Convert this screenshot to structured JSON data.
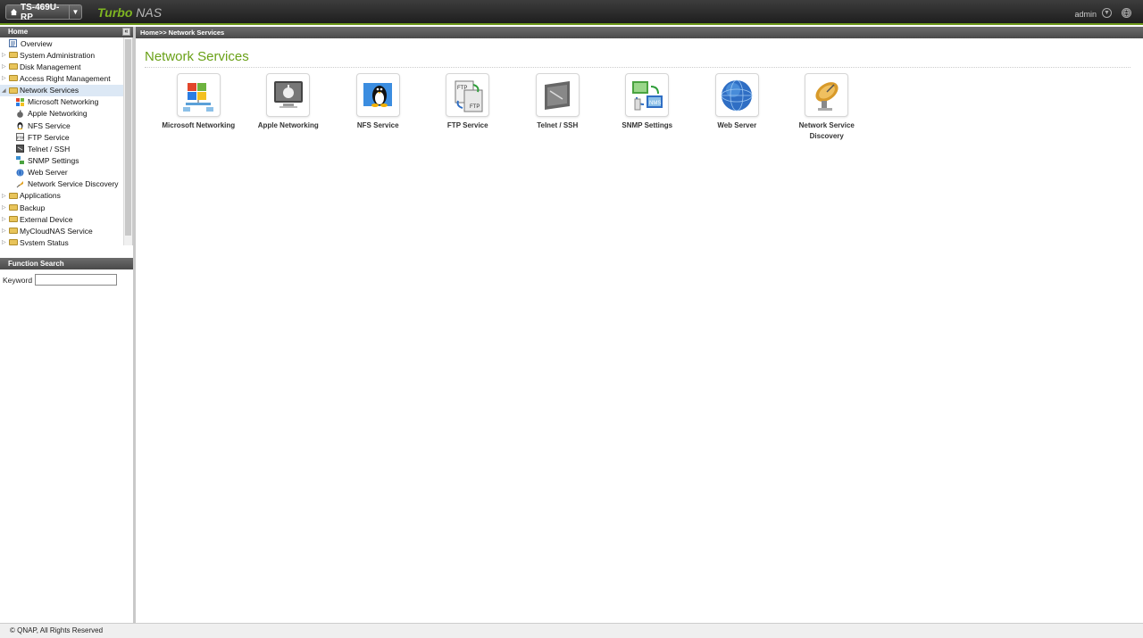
{
  "header": {
    "device_name": "TS-469U-RP",
    "brand_part1": "Turbo",
    "brand_part2": "NAS",
    "user": "admin"
  },
  "left_panel": {
    "title": "Home",
    "collapse_glyph": "«",
    "tree": [
      {
        "label": "Overview",
        "level": 0,
        "icon": "overview-icon"
      },
      {
        "label": "System Administration",
        "level": 0,
        "icon": "folder-icon"
      },
      {
        "label": "Disk Management",
        "level": 0,
        "icon": "folder-icon"
      },
      {
        "label": "Access Right Management",
        "level": 0,
        "icon": "folder-icon"
      },
      {
        "label": "Network Services",
        "level": 0,
        "icon": "folder-open-icon",
        "selected": true
      },
      {
        "label": "Microsoft Networking",
        "level": 1,
        "icon": "windows-icon"
      },
      {
        "label": "Apple Networking",
        "level": 1,
        "icon": "apple-icon"
      },
      {
        "label": "NFS Service",
        "level": 1,
        "icon": "linux-icon"
      },
      {
        "label": "FTP Service",
        "level": 1,
        "icon": "ftp-icon"
      },
      {
        "label": "Telnet / SSH",
        "level": 1,
        "icon": "terminal-icon"
      },
      {
        "label": "SNMP Settings",
        "level": 1,
        "icon": "snmp-icon"
      },
      {
        "label": "Web Server",
        "level": 1,
        "icon": "globe-icon"
      },
      {
        "label": "Network Service Discovery",
        "level": 1,
        "icon": "satellite-icon"
      },
      {
        "label": "Applications",
        "level": 0,
        "icon": "folder-icon"
      },
      {
        "label": "Backup",
        "level": 0,
        "icon": "folder-icon"
      },
      {
        "label": "External Device",
        "level": 0,
        "icon": "folder-icon"
      },
      {
        "label": "MyCloudNAS Service",
        "level": 0,
        "icon": "folder-icon"
      },
      {
        "label": "System Status",
        "level": 0,
        "icon": "folder-icon"
      }
    ],
    "search": {
      "title": "Function Search",
      "keyword_label": "Keyword",
      "value": ""
    }
  },
  "main": {
    "breadcrumb": "Home>> Network Services",
    "title": "Network Services",
    "tiles": [
      {
        "label": "Microsoft Networking",
        "icon": "windows-network-icon"
      },
      {
        "label": "Apple Networking",
        "icon": "apple-icon"
      },
      {
        "label": "NFS Service",
        "icon": "linux-penguin-icon"
      },
      {
        "label": "FTP Service",
        "icon": "ftp-icon"
      },
      {
        "label": "Telnet / SSH",
        "icon": "terminal-icon"
      },
      {
        "label": "SNMP Settings",
        "icon": "snmp-icon"
      },
      {
        "label": "Web Server",
        "icon": "globe-icon"
      },
      {
        "label": "Network Service Discovery",
        "icon": "satellite-dish-icon"
      }
    ]
  },
  "footer": {
    "copyright": "© QNAP, All Rights Reserved"
  },
  "colors": {
    "accent_green": "#6aa118",
    "header_dark": "#2a2a2a",
    "selection": "#dce8f5"
  }
}
